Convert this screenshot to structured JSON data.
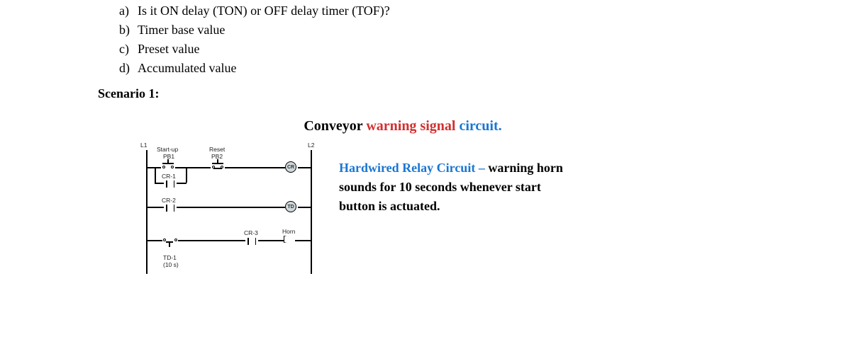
{
  "questions": {
    "a": {
      "marker": "a)",
      "text": "Is it ON delay (TON) or OFF delay timer (TOF)?"
    },
    "b": {
      "marker": "b)",
      "text": "Timer base value"
    },
    "c": {
      "marker": "c)",
      "text": "Preset value"
    },
    "d": {
      "marker": "d)",
      "text": "Accumulated value"
    }
  },
  "scenario_label": "Scenario 1:",
  "diagram_title": {
    "part1": "Conveyor ",
    "part2": "warning signal ",
    "part3": "circuit."
  },
  "circuit": {
    "L1": "L1",
    "L2": "L2",
    "startup": "Start-up",
    "pb1": "PB1",
    "reset": "Reset",
    "pb2": "PB2",
    "cr1": "CR-1",
    "cr2": "CR-2",
    "cr3": "CR-3",
    "cr_coil": "CR",
    "td_coil": "TD",
    "horn": "Horn",
    "td1": "TD-1",
    "td1_time": "(10 s)"
  },
  "description": {
    "title": "Hardwired Relay Circuit – ",
    "body": "warning horn sounds for 10 seconds whenever start button is actuated."
  }
}
